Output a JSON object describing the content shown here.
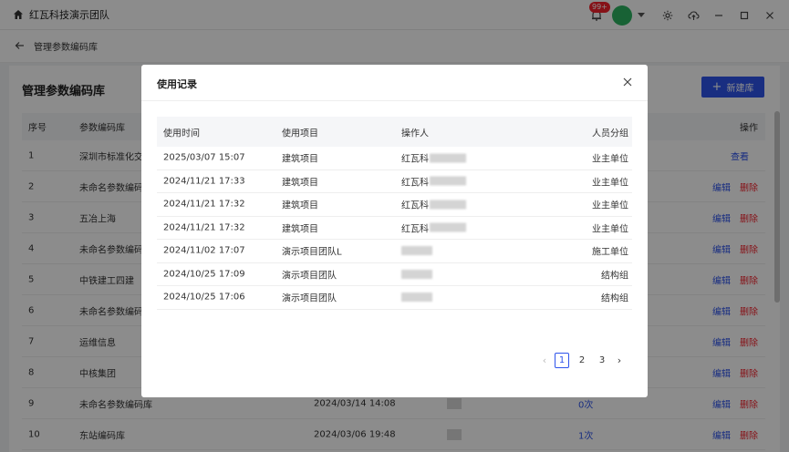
{
  "titlebar": {
    "app_title": "红瓦科技演示团队",
    "notification_count": "99+"
  },
  "breadcrumb": {
    "text": "管理参数编码库"
  },
  "page": {
    "title": "管理参数编码库",
    "new_button_label": "新建库",
    "table": {
      "headers": {
        "no": "序号",
        "name": "参数编码库",
        "ops": "操作"
      },
      "rows": [
        {
          "no": "1",
          "name": "深圳市标准化交",
          "time": "",
          "count": "",
          "ops": [
            "查看"
          ]
        },
        {
          "no": "2",
          "name": "未命名参数编码",
          "time": "",
          "count": "",
          "ops": [
            "编辑",
            "删除"
          ]
        },
        {
          "no": "3",
          "name": "五冶上海",
          "time": "",
          "count": "",
          "ops": [
            "编辑",
            "删除"
          ]
        },
        {
          "no": "4",
          "name": "未命名参数编码",
          "time": "",
          "count": "",
          "ops": [
            "编辑",
            "删除"
          ]
        },
        {
          "no": "5",
          "name": "中铁建工四建",
          "time": "",
          "count": "",
          "ops": [
            "编辑",
            "删除"
          ]
        },
        {
          "no": "6",
          "name": "未命名参数编码",
          "time": "",
          "count": "",
          "ops": [
            "编辑",
            "删除"
          ]
        },
        {
          "no": "7",
          "name": "运维信息",
          "time": "",
          "count": "",
          "ops": [
            "编辑",
            "删除"
          ]
        },
        {
          "no": "8",
          "name": "中核集团",
          "time": "",
          "count": "",
          "ops": [
            "编辑",
            "删除"
          ]
        },
        {
          "no": "9",
          "name": "未命名参数编码库",
          "time": "2024/03/14 14:08",
          "count": "0次",
          "ops": [
            "编辑",
            "删除"
          ]
        },
        {
          "no": "10",
          "name": "东站编码库",
          "time": "2024/03/06 19:48",
          "count": "1次",
          "ops": [
            "编辑",
            "删除"
          ]
        }
      ]
    }
  },
  "modal": {
    "title": "使用记录",
    "headers": {
      "time": "使用时间",
      "project": "使用项目",
      "operator": "操作人",
      "group": "人员分组"
    },
    "rows": [
      {
        "time": "2025/03/07 15:07",
        "project": "建筑项目",
        "operator": "红瓦科",
        "group": "业主单位"
      },
      {
        "time": "2024/11/21 17:33",
        "project": "建筑项目",
        "operator": "红瓦科",
        "group": "业主单位"
      },
      {
        "time": "2024/11/21 17:32",
        "project": "建筑项目",
        "operator": "红瓦科",
        "group": "业主单位"
      },
      {
        "time": "2024/11/21 17:32",
        "project": "建筑项目",
        "operator": "红瓦科",
        "group": "业主单位"
      },
      {
        "time": "2024/11/02 17:07",
        "project": "演示项目团队L",
        "operator": "",
        "group": "施工单位"
      },
      {
        "time": "2024/10/25 17:09",
        "project": "演示项目团队",
        "operator": "",
        "group": "结构组"
      },
      {
        "time": "2024/10/25 17:06",
        "project": "演示项目团队",
        "operator": "",
        "group": "结构组"
      }
    ],
    "pagination": {
      "pages": [
        "1",
        "2",
        "3"
      ],
      "current": "1"
    }
  },
  "colors": {
    "primary": "#2f54eb",
    "danger": "#f5222d",
    "avatar": "#2db262"
  }
}
